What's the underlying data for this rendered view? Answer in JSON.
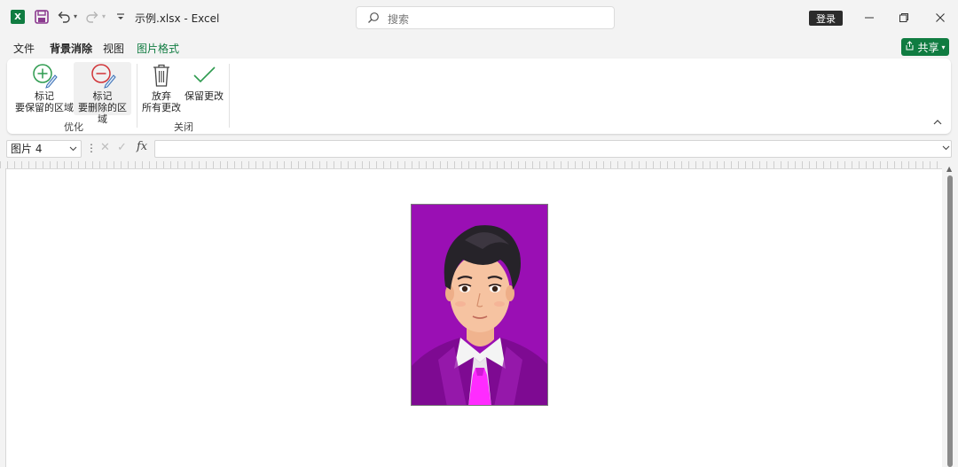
{
  "app": {
    "doc_title": "示例.xlsx  -  Excel",
    "logo_letter": "X"
  },
  "search": {
    "placeholder": "搜索"
  },
  "account": {
    "login_label": "登录"
  },
  "menu": {
    "tabs": [
      "文件",
      "背景消除",
      "视图",
      "图片格式"
    ],
    "active_tab": "背景消除",
    "share_label": "共享"
  },
  "ribbon": {
    "groups": [
      {
        "label": "优化",
        "buttons": [
          {
            "line1": "标记",
            "line2": "要保留的区域",
            "icon": "mark-keep-plus-pen-icon"
          },
          {
            "line1": "标记",
            "line2": "要删除的区域",
            "icon": "mark-remove-minus-pen-icon"
          }
        ]
      },
      {
        "label": "关闭",
        "buttons": [
          {
            "line1": "放弃",
            "line2": "所有更改",
            "icon": "trash-icon"
          },
          {
            "line1": "保留更改",
            "line2": "",
            "icon": "checkmark-icon"
          }
        ]
      }
    ]
  },
  "formula_bar": {
    "name_box": "图片 4",
    "formula": ""
  },
  "colors": {
    "excel_green": "#107c41",
    "picture_background": "#9a0fb4"
  }
}
